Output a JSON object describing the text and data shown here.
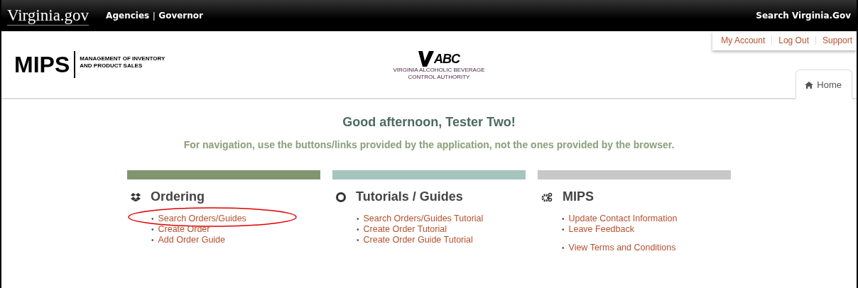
{
  "top_bar": {
    "logo": "Virginia.gov",
    "links": [
      "Agencies",
      "Governor"
    ],
    "separator": "|",
    "search": "Search Virginia.Gov"
  },
  "account_links": [
    {
      "label": "My Account"
    },
    {
      "label": "Log Out"
    },
    {
      "label": "Support"
    }
  ],
  "header": {
    "app_name": "MIPS",
    "app_subtitle": [
      "MANAGEMENT OF INVENTORY",
      "AND PRODUCT SALES"
    ],
    "agency_logo": "ABC",
    "agency_name": [
      "VIRGINIA ALCOHOLIC BEVERAGE",
      "CONTROL AUTHORITY"
    ]
  },
  "tabs": [
    {
      "label": "Home",
      "selected": true
    }
  ],
  "greeting": "Good afternoon, Tester Two!",
  "notice": "For navigation, use the buttons/links provided by the application, not the ones provided by the browser.",
  "sections": [
    {
      "title": "Ordering",
      "color": "#7f9670",
      "groups": [
        [
          {
            "label": "Search Orders/Guides",
            "bullet": "•",
            "circled": true
          },
          {
            "label": "Create Order",
            "bullet": "•",
            "circled": false
          },
          {
            "label": "Add Order Guide",
            "bullet": "•",
            "circled": false
          }
        ]
      ]
    },
    {
      "title": "Tutorials / Guides",
      "color": "#a5c4bc",
      "groups": [
        [
          {
            "label": "Search Orders/Guides Tutorial",
            "bullet": "•",
            "circled": false
          },
          {
            "label": "Create Order Tutorial",
            "bullet": "•",
            "circled": false
          },
          {
            "label": "Create Order Guide Tutorial",
            "bullet": "•",
            "circled": false
          }
        ]
      ]
    },
    {
      "title": "MIPS",
      "color": "#c8c8c8",
      "groups": [
        [
          {
            "label": "Update Contact Information",
            "bullet": "•",
            "circled": false
          },
          {
            "label": "Leave Feedback",
            "bullet": "•",
            "circled": false
          }
        ],
        [
          {
            "label": "View Terms and Conditions",
            "bullet": "•",
            "circled": false
          }
        ]
      ]
    }
  ]
}
